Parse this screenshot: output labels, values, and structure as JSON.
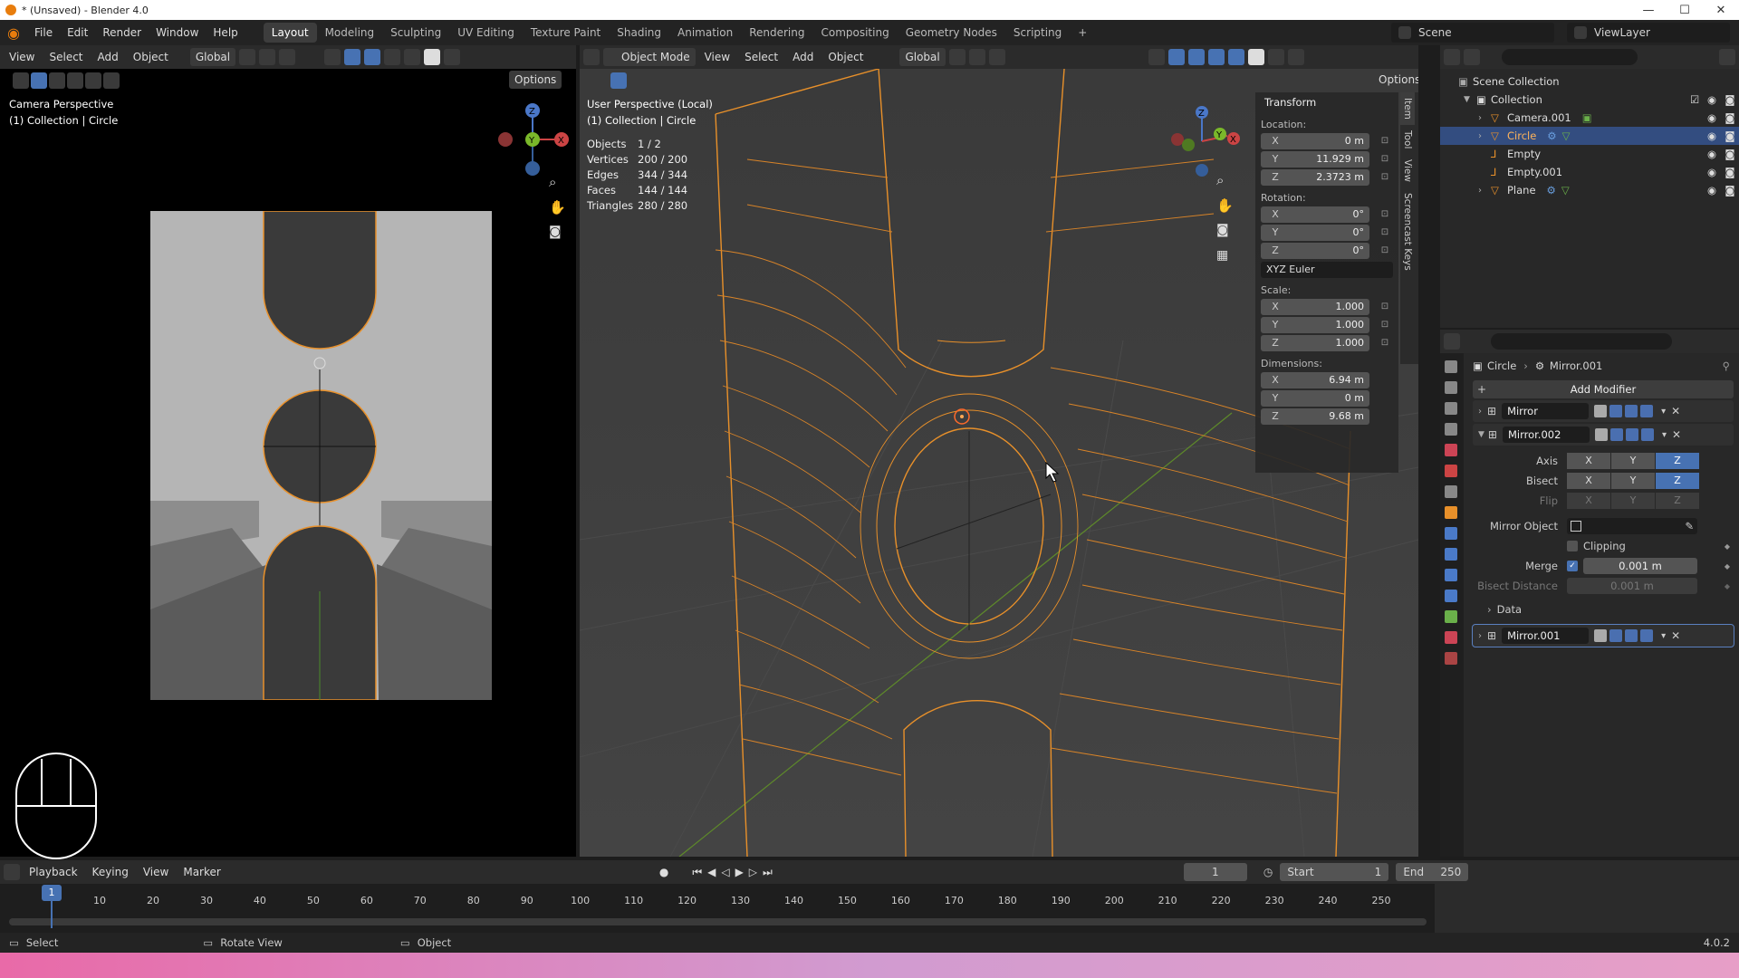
{
  "titlebar": {
    "title": "* (Unsaved) - Blender 4.0"
  },
  "topbar": {
    "menus": [
      "File",
      "Edit",
      "Render",
      "Window",
      "Help"
    ],
    "workspaces": [
      "Layout",
      "Modeling",
      "Sculpting",
      "UV Editing",
      "Texture Paint",
      "Shading",
      "Animation",
      "Rendering",
      "Compositing",
      "Geometry Nodes",
      "Scripting"
    ],
    "active_workspace": "Layout",
    "scene": "Scene",
    "view_layer": "ViewLayer"
  },
  "left_viewport": {
    "header_menus": [
      "View",
      "Select",
      "Add",
      "Object"
    ],
    "orientation": "Global",
    "options_label": "Options",
    "overlay_title": "Camera Perspective",
    "overlay_sub": "(1) Collection | Circle"
  },
  "main_viewport": {
    "mode": "Object Mode",
    "header_menus": [
      "View",
      "Select",
      "Add",
      "Object"
    ],
    "orientation": "Global",
    "options_label": "Options",
    "overlay_title": "User Perspective (Local)",
    "overlay_sub": "(1) Collection | Circle",
    "stats": [
      {
        "k": "Objects",
        "v": "1 / 2"
      },
      {
        "k": "Vertices",
        "v": "200 / 200"
      },
      {
        "k": "Edges",
        "v": "344 / 344"
      },
      {
        "k": "Faces",
        "v": "144 / 144"
      },
      {
        "k": "Triangles",
        "v": "280 / 280"
      }
    ]
  },
  "n_panel": {
    "title": "Transform",
    "location_label": "Location:",
    "location": [
      {
        "ax": "X",
        "v": "0 m"
      },
      {
        "ax": "Y",
        "v": "11.929 m"
      },
      {
        "ax": "Z",
        "v": "2.3723 m"
      }
    ],
    "rotation_label": "Rotation:",
    "rotation": [
      {
        "ax": "X",
        "v": "0°"
      },
      {
        "ax": "Y",
        "v": "0°"
      },
      {
        "ax": "Z",
        "v": "0°"
      }
    ],
    "rotation_mode": "XYZ Euler",
    "scale_label": "Scale:",
    "scale": [
      {
        "ax": "X",
        "v": "1.000"
      },
      {
        "ax": "Y",
        "v": "1.000"
      },
      {
        "ax": "Z",
        "v": "1.000"
      }
    ],
    "dimensions_label": "Dimensions:",
    "dimensions": [
      {
        "ax": "X",
        "v": "6.94 m"
      },
      {
        "ax": "Y",
        "v": "0 m"
      },
      {
        "ax": "Z",
        "v": "9.68 m"
      }
    ],
    "tabs": [
      "Item",
      "Tool",
      "View",
      "Screencast Keys"
    ]
  },
  "outliner": {
    "scene_collection": "Scene Collection",
    "collection": "Collection",
    "items": [
      "Camera.001",
      "Circle",
      "Empty",
      "Empty.001",
      "Plane"
    ],
    "selected": "Circle"
  },
  "properties": {
    "breadcrumb_object": "Circle",
    "breadcrumb_modifier": "Mirror.001",
    "add_modifier": "Add Modifier",
    "modifiers": [
      "Mirror",
      "Mirror.002",
      "Mirror.001"
    ],
    "axis_label": "Axis",
    "bisect_label": "Bisect",
    "flip_label": "Flip",
    "axes": [
      "X",
      "Y",
      "Z"
    ],
    "mirror_object_label": "Mirror Object",
    "clipping_label": "Clipping",
    "merge_label": "Merge",
    "merge_value": "0.001 m",
    "bisect_distance_label": "Bisect Distance",
    "bisect_distance_value": "0.001 m",
    "data_label": "Data"
  },
  "timeline": {
    "menus": [
      "Playback",
      "Keying",
      "View",
      "Marker"
    ],
    "current_frame": "1",
    "start_label": "Start",
    "start": "1",
    "end_label": "End",
    "end": "250",
    "ticks": [
      "1",
      "10",
      "20",
      "30",
      "40",
      "50",
      "60",
      "70",
      "80",
      "90",
      "100",
      "110",
      "120",
      "130",
      "140",
      "150",
      "160",
      "170",
      "180",
      "190",
      "200",
      "210",
      "220",
      "230",
      "240",
      "250"
    ]
  },
  "statusbar": {
    "select": "Select",
    "rotate": "Rotate View",
    "object": "Object",
    "version": "4.0.2"
  }
}
